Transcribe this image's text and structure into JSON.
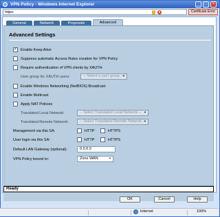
{
  "window": {
    "title": "VPN Policy - Windows Internet Explorer"
  },
  "address": {
    "protocol": "https:",
    "certificate": "Certificate Error"
  },
  "tabs": [
    {
      "label": "General"
    },
    {
      "label": "Network"
    },
    {
      "label": "Proposals"
    },
    {
      "label": "Advanced",
      "active": true
    }
  ],
  "section": {
    "title": "Advanced Settings"
  },
  "options": {
    "keep_alive": {
      "label": "Enable Keep Alive",
      "checked": true
    },
    "suppress_rules": {
      "label": "Suppress automatic Access Rules creation for VPN Policy",
      "checked": false
    },
    "require_xauth": {
      "label": "Require authentication of VPN clients by XAUTH",
      "checked": false
    },
    "xauth_group": {
      "label": "User group for XAUTH users:",
      "value": "-- Select a user group --"
    },
    "netbios": {
      "label": "Enable Windows Networking (NetBIOS) Broadcast",
      "checked": false
    },
    "multicast": {
      "label": "Enable Multicast",
      "checked": false
    },
    "nat": {
      "label": "Apply NAT Policies",
      "checked": false
    },
    "translated_local": {
      "label": "Translated Local Network:",
      "value": "-- Select Translated Local Network --"
    },
    "translated_remote": {
      "label": "Translated Remote Network:",
      "value": "-- Select Translated Remote Network --"
    },
    "management": {
      "label": "Management via this SA:",
      "http": "HTTP",
      "https": "HTTPS"
    },
    "user_login": {
      "label": "User login via this SA:",
      "http": "HTTP",
      "https": "HTTPS"
    },
    "gateway": {
      "label": "Default LAN Gateway (optional):",
      "value": "0.0.0.0"
    },
    "bound_to": {
      "label": "VPN Policy bound to:",
      "value": "Zone WAN"
    }
  },
  "status": {
    "text": "Ready"
  },
  "buttons": {
    "ok": "OK",
    "cancel": "Cancel",
    "help": "Help"
  },
  "ie_status": {
    "zone": "Internet",
    "zoom": "100%"
  },
  "colors": {
    "panel": "#b9cee0",
    "tab": "#3d6e9e",
    "titlebar": "#2f63c2"
  }
}
